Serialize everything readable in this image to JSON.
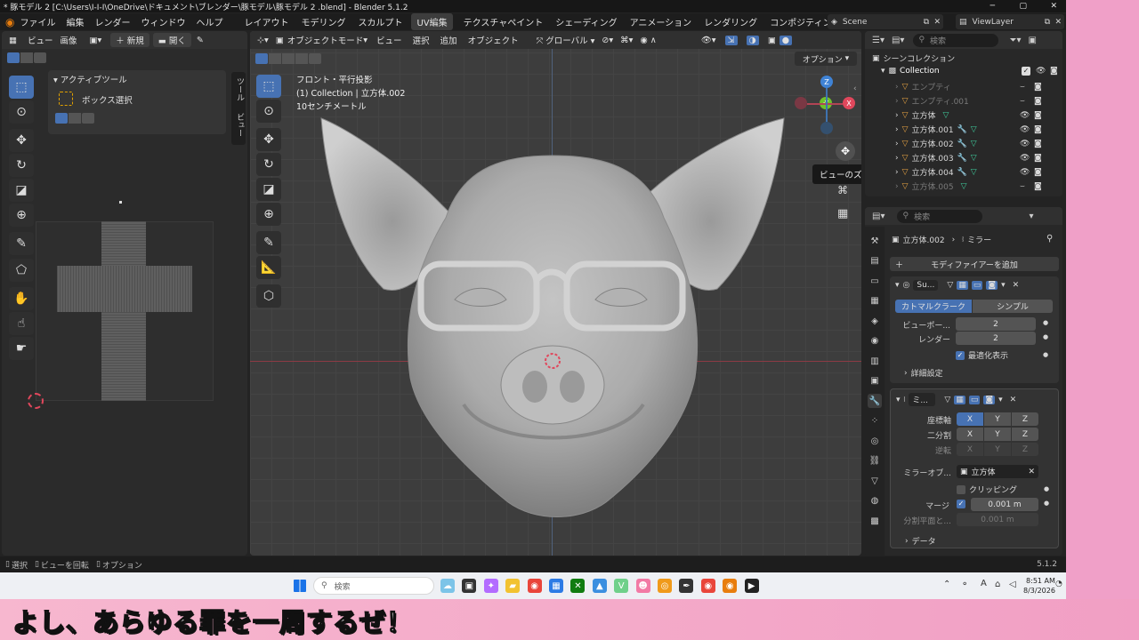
{
  "window": {
    "title": "* 豚モデル 2  [C:\\Users\\I-I-I\\OneDrive\\ドキュメント\\ブレンダー\\豚モデル\\豚モデル 2 .blend] - Blender 5.1.2"
  },
  "menu": {
    "items": [
      "ファイル",
      "編集",
      "レンダー",
      "ウィンドウ",
      "ヘルプ"
    ],
    "workspaces": [
      "レイアウト",
      "モデリング",
      "スカルプト",
      "UV編集",
      "テクスチャペイント",
      "シェーディング",
      "アニメーション",
      "レンダリング",
      "コンポジティング"
    ],
    "active_workspace": "UV編集",
    "scene": "Scene",
    "view_layer": "ViewLayer"
  },
  "uv_editor": {
    "header": {
      "view": "ビュー",
      "image": "画像",
      "new": "新規",
      "open": "開く"
    },
    "panel_title": "アクティブツール",
    "box_select": "ボックス選択",
    "side_tabs": [
      "ツール",
      "ビュー"
    ]
  },
  "viewport": {
    "mode": "オブジェクトモード",
    "menus": [
      "ビュー",
      "選択",
      "追加",
      "オブジェクト"
    ],
    "orientation": "グローバル",
    "overlay_lines": [
      "フロント・平行投影",
      "(1) Collection | 立方体.002",
      "10センチメートル"
    ],
    "options": "オプション",
    "tooltip": "ビューのズームイン・アウト",
    "gizmo": {
      "z": "Z",
      "y": "-Y",
      "x": "X"
    }
  },
  "outliner": {
    "search_placeholder": "検索",
    "root": "シーンコレクション",
    "collection": "Collection",
    "items": [
      {
        "name": "エンプティ",
        "dim": true
      },
      {
        "name": "エンプティ.001",
        "dim": true
      },
      {
        "name": "立方体",
        "dim": false
      },
      {
        "name": "立方体.001",
        "dim": false
      },
      {
        "name": "立方体.002",
        "dim": false
      },
      {
        "name": "立方体.003",
        "dim": false
      },
      {
        "name": "立方体.004",
        "dim": false
      },
      {
        "name": "立方体.005",
        "dim": true
      }
    ]
  },
  "properties": {
    "search_placeholder": "検索",
    "breadcrumb_object": "立方体.002",
    "breadcrumb_modifier": "ミラー",
    "add_modifier": "モディファイアーを追加",
    "subsurf": {
      "name": "Su...",
      "tab_catmull": "カトマルクラーク",
      "tab_simple": "シンプル",
      "viewport_label": "ビューポー...",
      "viewport_value": "2",
      "render_label": "レンダー",
      "render_value": "2",
      "optimal_display": "最適化表示",
      "advanced": "詳細設定"
    },
    "mirror": {
      "name": "ミ...",
      "axis_label": "座標軸",
      "bisect_label": "二分割",
      "flip_label": "逆転",
      "x": "X",
      "y": "Y",
      "z": "Z",
      "mirror_object_label": "ミラーオブ...",
      "mirror_object_value": "立方体",
      "clipping": "クリッピング",
      "merge_label": "マージ",
      "merge_value": "0.001 m",
      "bisect_distance_label": "分割平面と...",
      "bisect_distance_value": "0.001 m",
      "data": "データ"
    }
  },
  "statusbar": {
    "select": "選択",
    "rotate": "ビューを回転",
    "options": "オプション",
    "version": "5.1.2"
  },
  "taskbar": {
    "search_placeholder": "検索",
    "time": "8:51 AM",
    "date": "8/3/2026",
    "ime": "A"
  },
  "subtitle": "よし、あらゆる罪を一周するぜ！",
  "colors": {
    "accent": "#4772b3",
    "axis_red": "#e0475c",
    "axis_green": "#6fc22b",
    "axis_blue": "#3f83d6",
    "subtitle_bg": "#f2a7c6"
  }
}
